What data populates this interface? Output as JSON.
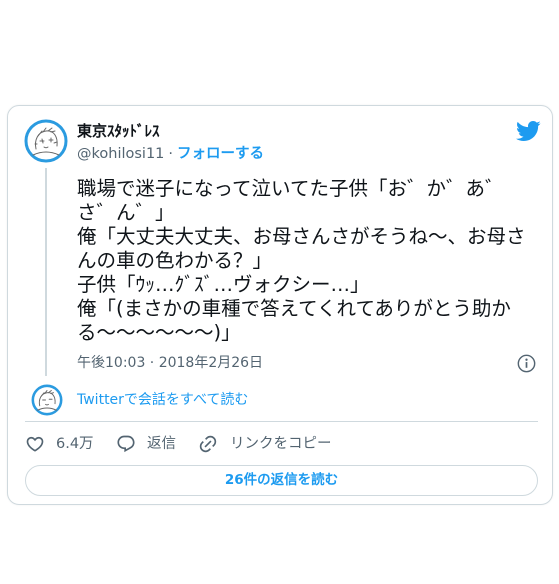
{
  "tweet": {
    "author": {
      "name": "東京ｽﾀｯﾄﾞﾚｽ",
      "handle": "@kohilosi11",
      "separator": "·",
      "follow_label": "フォローする"
    },
    "text_lines": [
      "職場で迷子になって泣いてた子供「お゛か゛あ゛",
      "さ゛ん゛」",
      "俺「大丈夫大丈夫、お母さんさがそうね～、お母さ",
      "んの車の色わかる？」",
      "子供「ｳｯ…ｸﾞｽﾞ…ヴォクシー…」",
      "俺「(まさかの車種で答えてくれてありがとう助か",
      "る～～～～～～)」"
    ],
    "timestamp": "午後10:03 · 2018年2月26日",
    "conversation_link": "Twitterで会話をすべて読む",
    "actions": {
      "likes": "6.4万",
      "reply_label": "返信",
      "copy_link_label": "リンクをコピー"
    },
    "read_replies_button": "26件の返信を読む"
  },
  "icons": {
    "logo": "twitter-bird-icon",
    "info": "info-icon",
    "like": "heart-icon",
    "reply": "reply-icon",
    "copy_link": "link-icon"
  },
  "colors": {
    "accent": "#1d9bf0",
    "text": "#0f1419",
    "secondary": "#536471",
    "border": "#cfd9de"
  }
}
